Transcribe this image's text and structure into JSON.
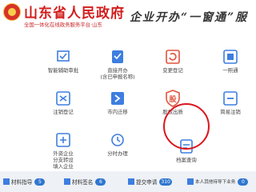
{
  "header": {
    "title": "山东省人民政府",
    "subtitle": "全国一体化在线政务服务平台·山东",
    "slogan": "企业开办“一窗通”服"
  },
  "tiles": [
    {
      "label": "智能辅助审批",
      "icon": "stamp-icon"
    },
    {
      "label": "直接开办",
      "label2": "(含已申报名称)",
      "icon": "approval-icon"
    },
    {
      "label": "变更登记",
      "icon": "refresh-icon"
    },
    {
      "label": "一照通",
      "icon": "license-icon"
    },
    {
      "label": "注销登记",
      "icon": "cancel-icon"
    },
    {
      "label": "市内迁移",
      "icon": "transfer-icon"
    },
    {
      "label": "股权出质",
      "icon": "shield-icon",
      "glyph": "股"
    },
    {
      "label": "简易注销",
      "icon": "cancel-simple-icon"
    },
    {
      "label": "外资企业",
      "label2": "分支转设",
      "label3": "填入企业",
      "icon": "branch-icon"
    },
    {
      "label": "分时办理",
      "icon": "clock-icon"
    },
    {
      "label": "档案查询",
      "icon": "archive-icon"
    }
  ],
  "footer": {
    "items": [
      {
        "label": "材料指导",
        "count": "5"
      },
      {
        "label": "材料签名",
        "count": "6"
      },
      {
        "label": "提交申请",
        "count": "310"
      },
      {
        "label": "本人其他待导下业务",
        "count": "0"
      }
    ]
  },
  "colors": {
    "accent": "#d21d1d",
    "tile_blue": "#3d7ee0",
    "tile_red": "#e0533b",
    "highlight": "#d9171e"
  }
}
